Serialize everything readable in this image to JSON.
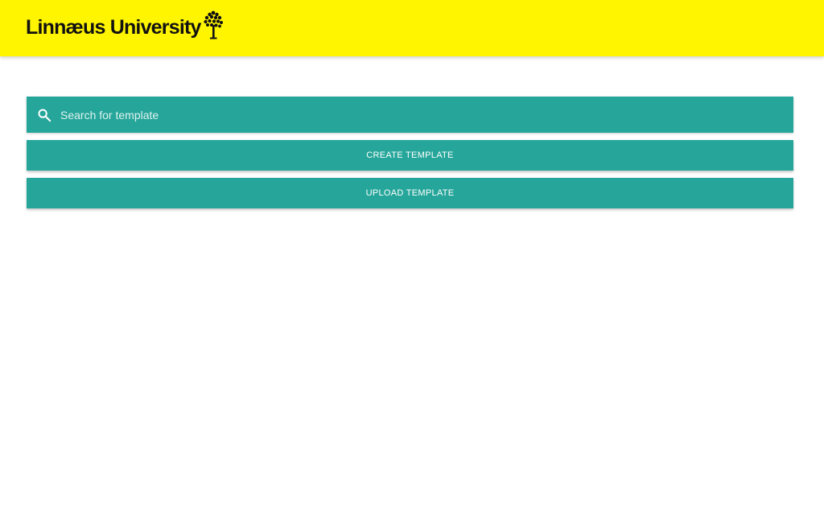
{
  "header": {
    "logo_text": "Linnæus University",
    "background_color": "#fff500",
    "logo_icon": "tree-icon"
  },
  "search": {
    "placeholder": "Search for template",
    "value": "",
    "icon": "search-icon"
  },
  "actions": {
    "create_label": "CREATE TEMPLATE",
    "upload_label": "UPLOAD TEMPLATE"
  },
  "colors": {
    "accent": "#26a69a",
    "text_on_accent": "#ffffff"
  }
}
